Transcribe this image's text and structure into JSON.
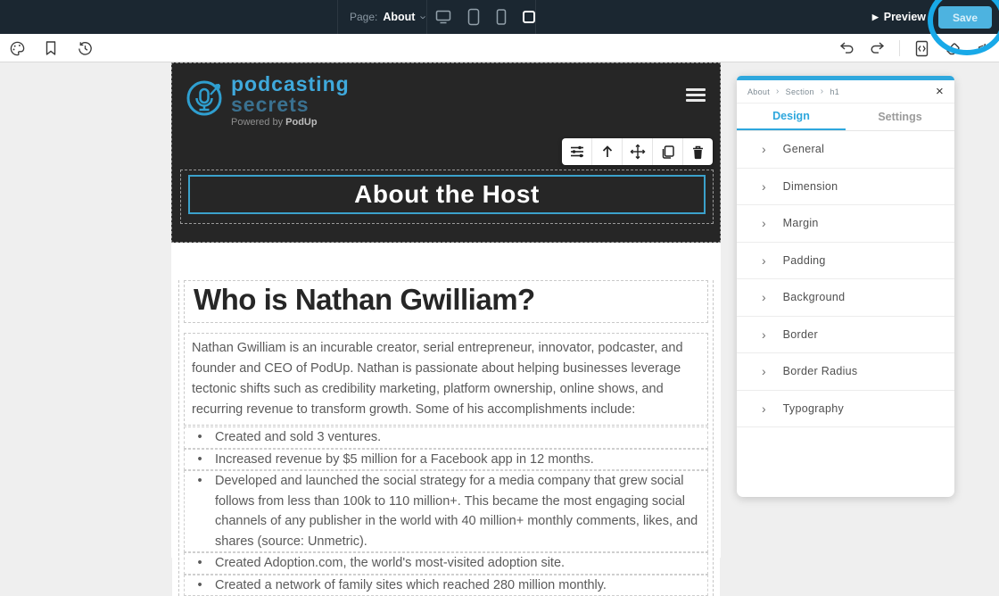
{
  "colors": {
    "accent_blue": "#2ea7dd",
    "save_button": "#4db3e0",
    "topbar_bg": "#1b2731",
    "canvas_header_bg": "#262626",
    "selection_border": "#3ba1cb",
    "annotation_circle": "#18a9e8",
    "logo_blue_light": "#3fa9dc",
    "logo_blue_dark": "#3a7190"
  },
  "icons": {
    "chevron_right": "›",
    "close": "×",
    "play": "▶",
    "bullet": "•",
    "code": "</>"
  },
  "topbar": {
    "page_label": "Page:",
    "page_value": "About",
    "preview_label": "Preview",
    "save_label": "Save"
  },
  "canvas": {
    "header": {
      "logo_line1": "podcasting",
      "logo_line2": "secrets",
      "powered_prefix": "Powered by",
      "powered_brand": "PodUp",
      "title": "About the Host"
    },
    "content": {
      "heading": "Who is Nathan Gwilliam?",
      "paragraph": "Nathan Gwilliam is an incurable creator, serial entrepreneur, innovator, podcaster, and founder and CEO of PodUp. Nathan is passionate about helping businesses leverage tectonic shifts such as credibility marketing, platform ownership, online shows, and recurring revenue to transform growth. Some of his accomplishments include:",
      "bullets": [
        "Created and sold 3 ventures.",
        "Increased revenue by $5 million for a Facebook app in 12 months.",
        "Developed and launched the social strategy for a media company that grew social follows from less than 100k to 110 million+. This became the most engaging social channels of any publisher in the world with 40 million+ monthly comments, likes, and shares (source: Unmetric).",
        "Created Adoption.com, the world's most-visited adoption site.",
        "Created a network of family sites which reached 280 million monthly."
      ]
    }
  },
  "panel": {
    "breadcrumb": [
      "About",
      "Section",
      "h1"
    ],
    "tabs": [
      {
        "label": "Design",
        "active": true
      },
      {
        "label": "Settings",
        "active": false
      }
    ],
    "sections": [
      "General",
      "Dimension",
      "Margin",
      "Padding",
      "Background",
      "Border",
      "Border Radius",
      "Typography"
    ]
  }
}
